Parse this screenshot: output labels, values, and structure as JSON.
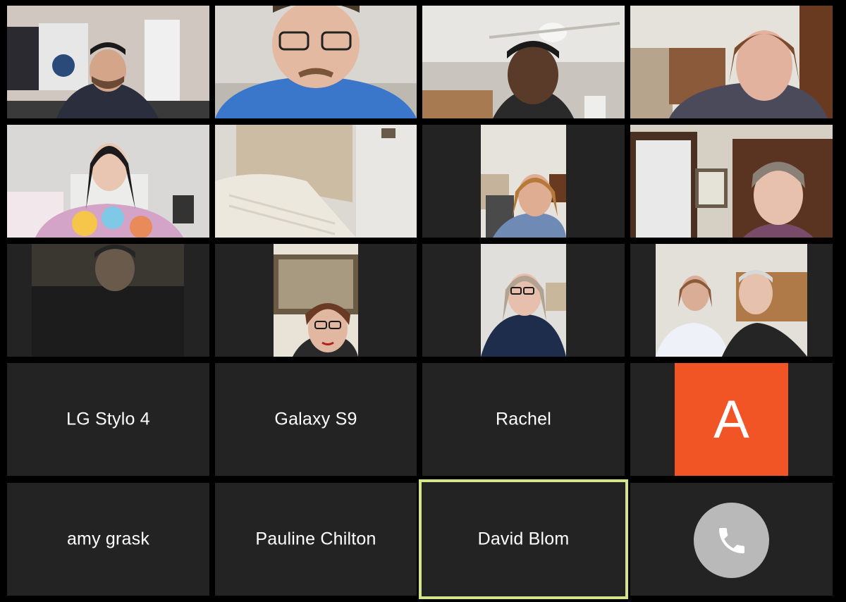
{
  "meeting": {
    "view": "gallery",
    "active_speaker": "David Blom"
  },
  "colors": {
    "background": "#000000",
    "tile_background": "#232323",
    "active_speaker_border": "#d4e48a",
    "avatar_background": "#f15526",
    "hangup_button": "#b9b9b9"
  },
  "name_tiles": {
    "lg_stylo_4": "LG Stylo 4",
    "galaxy_s9": "Galaxy S9",
    "rachel": "Rachel",
    "amy_grask": "amy grask",
    "pauline_chilton": "Pauline Chilton",
    "david_blom": "David Blom"
  },
  "avatar_tile": {
    "initial": "A"
  },
  "icons": {
    "hangup": "phone-icon"
  }
}
